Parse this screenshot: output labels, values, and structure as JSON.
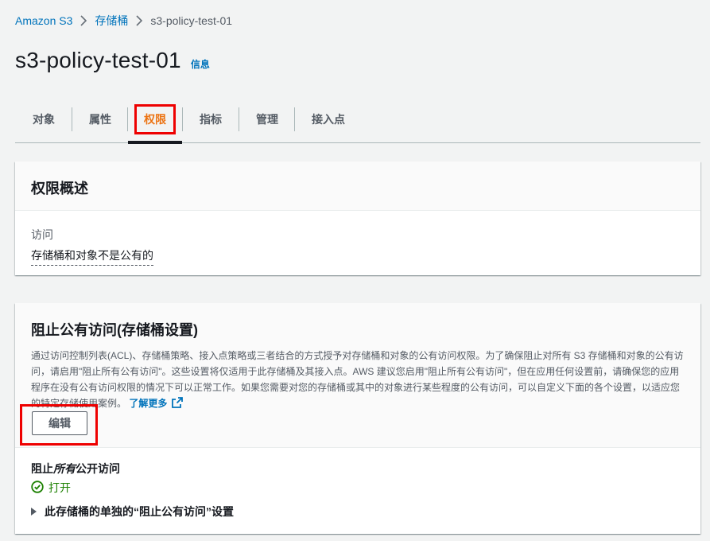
{
  "breadcrumb": {
    "items": [
      "Amazon S3",
      "存储桶",
      "s3-policy-test-01"
    ]
  },
  "header": {
    "title": "s3-policy-test-01",
    "info": "信息"
  },
  "tabs": [
    {
      "label": "对象"
    },
    {
      "label": "属性"
    },
    {
      "label": "权限",
      "active": true
    },
    {
      "label": "指标"
    },
    {
      "label": "管理"
    },
    {
      "label": "接入点"
    }
  ],
  "overview": {
    "title": "权限概述",
    "access_label": "访问",
    "access_value": "存储桶和对象不是公有的"
  },
  "block_public_access": {
    "title": "阻止公有访问(存储桶设置)",
    "description": "通过访问控制列表(ACL)、存储桶策略、接入点策略或三者结合的方式授予对存储桶和对象的公有访问权限。为了确保阻止对所有 S3 存储桶和对象的公有访问，请启用\"阻止所有公有访问\"。这些设置将仅适用于此存储桶及其接入点。AWS 建议您启用\"阻止所有公有访问\"，但在应用任何设置前，请确保您的应用程序在没有公有访问权限的情况下可以正常工作。如果您需要对您的存储桶或其中的对象进行某些程度的公有访问，可以自定义下面的各个设置，以适应您的特定存储使用案例。",
    "learn_more": "了解更多",
    "edit_label": "编辑",
    "status_title_prefix": "阻止",
    "status_title_em": "所有",
    "status_title_suffix": "公开访问",
    "status_value": "打开",
    "expand_label": "此存储桶的单独的“阻止公有访问”设置"
  },
  "colors": {
    "link": "#0073bb",
    "active_tab": "#ec7211",
    "success": "#1d8102",
    "highlight": "#ee0000"
  }
}
